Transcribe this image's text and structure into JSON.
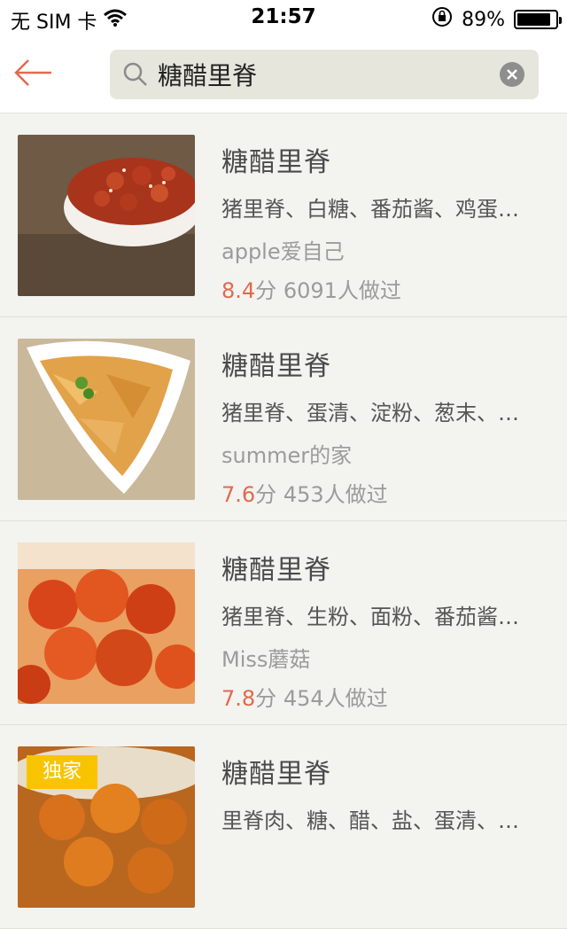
{
  "status_bar": {
    "carrier": "无 SIM 卡",
    "time": "21:57",
    "battery_percent": "89%",
    "battery_level": 0.89,
    "icons": [
      "wifi-icon",
      "rotation-lock-icon",
      "battery-icon"
    ]
  },
  "search": {
    "query": "糖醋里脊",
    "icons": [
      "back-arrow-icon",
      "search-icon",
      "clear-icon"
    ],
    "accent_color": "#e06a4e"
  },
  "recipes": [
    {
      "title": "糖醋里脊",
      "ingredients": "猪里脊、白糖、番茄酱、鸡蛋、淀粉",
      "author": "apple爱自己",
      "score": "8.4",
      "score_unit": "分",
      "made_count": "6091人做过",
      "badge": ""
    },
    {
      "title": "糖醋里脊",
      "ingredients": "猪里脊、蛋清、淀粉、葱末、姜末",
      "author": "summer的家",
      "score": "7.6",
      "score_unit": "分",
      "made_count": "453人做过",
      "badge": ""
    },
    {
      "title": "糖醋里脊",
      "ingredients": "猪里脊、生粉、面粉、番茄酱、白糖",
      "author": "Miss蘑菇",
      "score": "7.8",
      "score_unit": "分",
      "made_count": "454人做过",
      "badge": ""
    },
    {
      "title": "糖醋里脊",
      "ingredients": "里脊肉、糖、醋、盐、蛋清、淀粉",
      "author": "",
      "score": "",
      "score_unit": "",
      "made_count": "",
      "badge": "独家"
    }
  ]
}
